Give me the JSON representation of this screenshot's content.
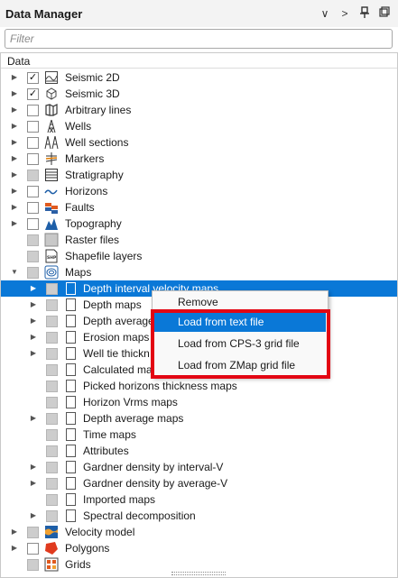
{
  "panel": {
    "title": "Data Manager",
    "filter_placeholder": "Filter",
    "column_header": "Data",
    "title_buttons": [
      "chevron-down-icon",
      "chevron-right-icon",
      "pin-icon",
      "float-icon"
    ]
  },
  "tree": {
    "items": [
      {
        "label": "Seismic 2D",
        "checked": true,
        "icon": "seismic-2d-icon"
      },
      {
        "label": "Seismic 3D",
        "checked": true,
        "icon": "seismic-3d-icon"
      },
      {
        "label": "Arbitrary lines",
        "icon": "arbitrary-lines-icon"
      },
      {
        "label": "Wells",
        "icon": "wells-icon"
      },
      {
        "label": "Well sections",
        "icon": "well-sections-icon"
      },
      {
        "label": "Markers",
        "icon": "markers-icon"
      },
      {
        "label": "Stratigraphy",
        "icon": "stratigraphy-icon"
      },
      {
        "label": "Horizons",
        "icon": "horizons-icon"
      },
      {
        "label": "Faults",
        "icon": "faults-icon"
      },
      {
        "label": "Topography",
        "icon": "topography-icon"
      },
      {
        "label": "Raster files",
        "icon": "raster-files-icon"
      },
      {
        "label": "Shapefile layers",
        "icon": "shapefile-icon"
      },
      {
        "label": "Maps",
        "icon": "maps-icon",
        "expanded": true
      },
      {
        "label": "Depth interval velocity maps",
        "selected": true
      },
      {
        "label": "Depth maps"
      },
      {
        "label": "Depth average"
      },
      {
        "label": "Erosion maps"
      },
      {
        "label": "Well tie thickn"
      },
      {
        "label": "Calculated ma"
      },
      {
        "label": "Picked horizons thickness maps"
      },
      {
        "label": "Horizon Vrms maps"
      },
      {
        "label": "Depth average maps"
      },
      {
        "label": "Time maps"
      },
      {
        "label": "Attributes"
      },
      {
        "label": "Gardner density by interval-V"
      },
      {
        "label": "Gardner density by average-V"
      },
      {
        "label": "Imported maps"
      },
      {
        "label": "Spectral decomposition"
      },
      {
        "label": "Velocity model",
        "icon": "velocity-model-icon"
      },
      {
        "label": "Polygons",
        "icon": "polygons-icon"
      },
      {
        "label": "Grids",
        "icon": "grids-icon"
      }
    ]
  },
  "context_menu": {
    "items": [
      "Remove",
      "Load from text file",
      "Load from CPS-3 grid file",
      "Load from ZMap grid file"
    ],
    "highlighted": "Load from text file"
  },
  "colors": {
    "selection": "#0a78d7",
    "annotation_box": "#e30613"
  }
}
